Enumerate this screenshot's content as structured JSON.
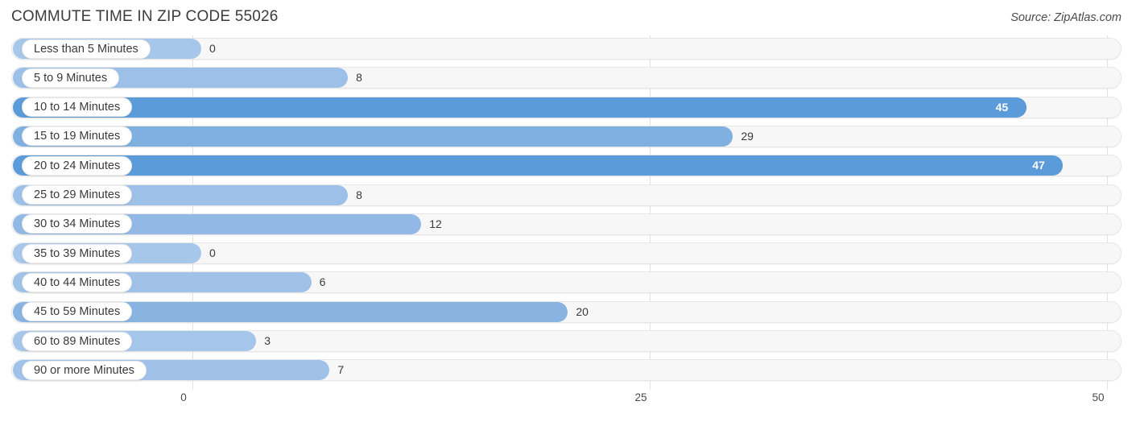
{
  "header": {
    "title": "COMMUTE TIME IN ZIP CODE 55026",
    "source": "Source: ZipAtlas.com"
  },
  "chart_data": {
    "type": "bar",
    "orientation": "horizontal",
    "title": "COMMUTE TIME IN ZIP CODE 55026",
    "xlabel": "",
    "ylabel": "",
    "xlim": [
      0,
      50
    ],
    "xticks": [
      0,
      25,
      50
    ],
    "xtick_labels": [
      "0",
      "25",
      "50"
    ],
    "grid": true,
    "legend": false,
    "categories": [
      "Less than 5 Minutes",
      "5 to 9 Minutes",
      "10 to 14 Minutes",
      "15 to 19 Minutes",
      "20 to 24 Minutes",
      "25 to 29 Minutes",
      "30 to 34 Minutes",
      "35 to 39 Minutes",
      "40 to 44 Minutes",
      "45 to 59 Minutes",
      "60 to 89 Minutes",
      "90 or more Minutes"
    ],
    "values": [
      0,
      8,
      45,
      29,
      47,
      8,
      12,
      0,
      6,
      20,
      3,
      7
    ],
    "value_labels": [
      "0",
      "8",
      "45",
      "29",
      "47",
      "8",
      "12",
      "0",
      "6",
      "20",
      "3",
      "7"
    ],
    "bar_colors": [
      "#a7c7ea",
      "#9dc0e8",
      "#5b9bd9",
      "#7fb0e0",
      "#5b9bd9",
      "#9dc0e8",
      "#92b8e5",
      "#a7c7ea",
      "#a0c2e9",
      "#89b4e2",
      "#a5c5ea",
      "#a0c2e9"
    ],
    "label_inside": [
      false,
      false,
      true,
      false,
      true,
      false,
      false,
      false,
      false,
      false,
      false,
      false
    ]
  },
  "colors": {
    "track": "#f7f7f7",
    "track_border": "#e6e6e6",
    "gridline": "#e2e2e2",
    "text": "#3a3a3a",
    "accent_dark": "#5b9bd9",
    "accent_light": "#a7c7ea"
  }
}
